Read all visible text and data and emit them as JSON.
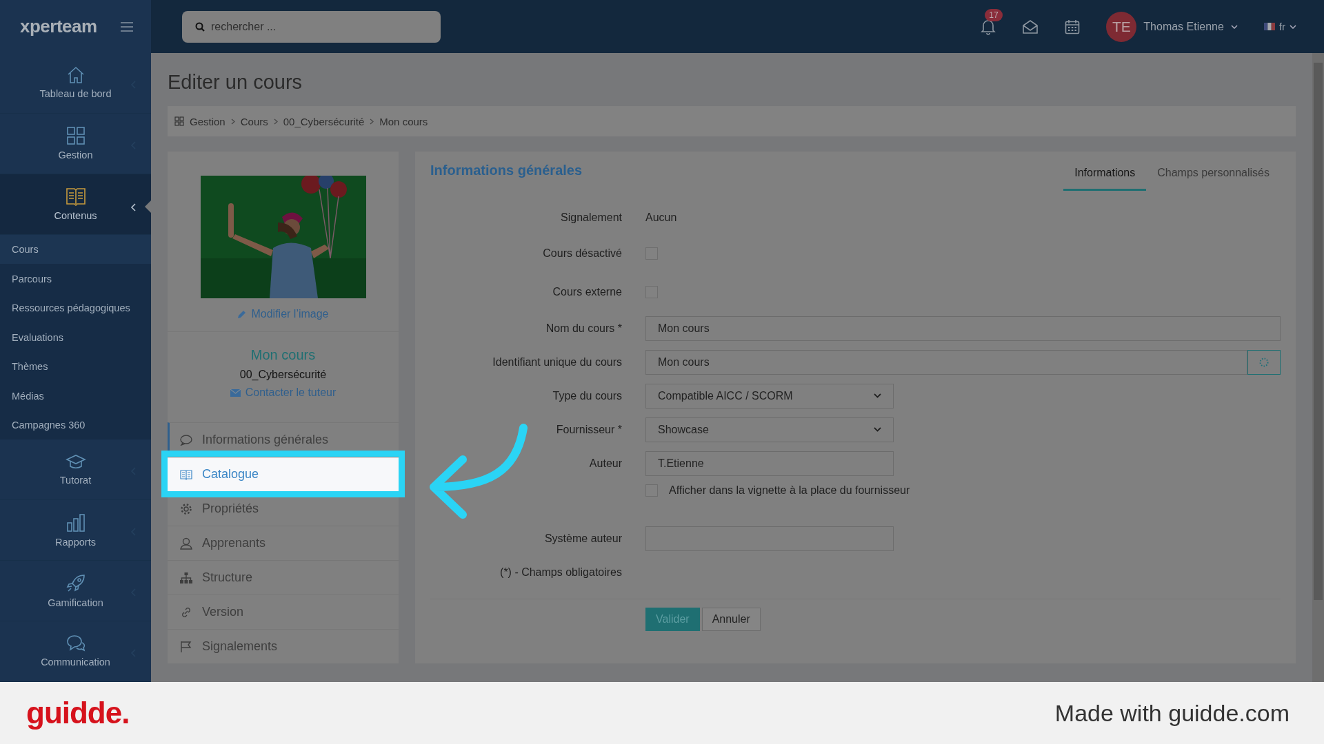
{
  "topbar": {
    "logo": "xperteam",
    "search": {
      "placeholder": "rechercher ..."
    },
    "notifications": {
      "count": "17"
    },
    "user": {
      "initials": "TE",
      "name": "Thomas Etienne"
    },
    "language": "fr"
  },
  "sidebar": {
    "sections": [
      {
        "label": "Tableau de bord",
        "kind": "home",
        "selected": false,
        "expanded": false
      },
      {
        "label": "Gestion",
        "kind": "grid",
        "selected": false,
        "expanded": false
      },
      {
        "label": "Contenus",
        "kind": "book",
        "selected": true,
        "expanded": true,
        "children": [
          {
            "label": "Cours",
            "selected": true
          },
          {
            "label": "Parcours",
            "selected": false
          },
          {
            "label": "Ressources pédagogiques",
            "selected": false
          },
          {
            "label": "Evaluations",
            "selected": false
          },
          {
            "label": "Thèmes",
            "selected": false
          },
          {
            "label": "Médias",
            "selected": false
          },
          {
            "label": "Campagnes 360",
            "selected": false
          }
        ]
      },
      {
        "label": "Tutorat",
        "kind": "cap",
        "selected": false,
        "expanded": false
      },
      {
        "label": "Rapports",
        "kind": "chart",
        "selected": false,
        "expanded": false
      },
      {
        "label": "Gamification",
        "kind": "rocket",
        "selected": false,
        "expanded": false
      },
      {
        "label": "Communication",
        "kind": "chat",
        "selected": false,
        "expanded": false
      }
    ]
  },
  "page": {
    "title": "Editer un cours",
    "breadcrumb": [
      "Gestion",
      "Cours",
      "00_Cybersécurité",
      "Mon cours"
    ]
  },
  "course_card": {
    "edit_image_link": "Modifier l’image",
    "title": "Mon cours",
    "category": "00_Cybersécurité",
    "contact_link": "Contacter le tuteur",
    "menu": [
      {
        "label": "Informations générales",
        "kind": "info",
        "selected": true,
        "highlighted": false
      },
      {
        "label": "Catalogue",
        "kind": "book",
        "selected": false,
        "highlighted": true
      },
      {
        "label": "Propriétés",
        "kind": "gear",
        "selected": false,
        "highlighted": false
      },
      {
        "label": "Apprenants",
        "kind": "user",
        "selected": false,
        "highlighted": false
      },
      {
        "label": "Structure",
        "kind": "tree",
        "selected": false,
        "highlighted": false
      },
      {
        "label": "Version",
        "kind": "link",
        "selected": false,
        "highlighted": false
      },
      {
        "label": "Signalements",
        "kind": "flag",
        "selected": false,
        "highlighted": false
      }
    ]
  },
  "form": {
    "heading": "Informations générales",
    "tabs": [
      {
        "label": "Informations",
        "selected": true
      },
      {
        "label": "Champs personnalisés",
        "selected": false
      }
    ],
    "fields": [
      {
        "kind": "text",
        "label": "Signalement",
        "value": "Aucun"
      },
      {
        "kind": "checkbox",
        "label": "Cours désactivé",
        "checked": false
      },
      {
        "kind": "checkbox",
        "label": "Cours externe",
        "checked": false
      },
      {
        "kind": "input",
        "label": "Nom du cours *",
        "value": "Mon cours"
      },
      {
        "kind": "generate",
        "label": "Identifiant unique du cours",
        "value": "Mon cours"
      },
      {
        "kind": "select",
        "label": "Type du cours",
        "value": "Compatible AICC / SCORM"
      },
      {
        "kind": "select",
        "label": "Fournisseur *",
        "value": "Showcase"
      },
      {
        "kind": "short",
        "label": "Auteur",
        "value": "T.Etienne"
      },
      {
        "kind": "option",
        "text": "Afficher dans la vignette à la place du fournisseur",
        "checked": false
      },
      {
        "kind": "short",
        "label": "Système auteur"
      }
    ],
    "note": "(*) - Champs obligatoires",
    "buttons": [
      {
        "label": "Valider",
        "kind": "primary"
      },
      {
        "label": "Annuler",
        "kind": "default"
      }
    ]
  },
  "footer": {
    "logo": "guidde.",
    "text": "Made with guidde.com"
  }
}
